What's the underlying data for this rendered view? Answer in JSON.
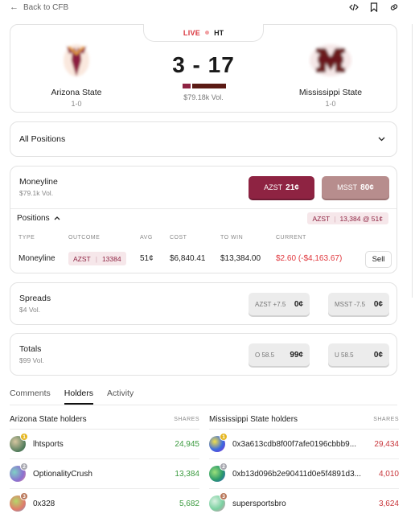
{
  "nav": {
    "back_label": "Back to CFB"
  },
  "game": {
    "live_label": "LIVE",
    "period": "HT",
    "score": "3 - 17",
    "volume": "$79.18k Vol.",
    "home": {
      "name": "Arizona State",
      "record": "1-0",
      "color": "#8e2342"
    },
    "away": {
      "name": "Mississippi State",
      "record": "1-0",
      "color": "#5b1a14"
    }
  },
  "positions_select": {
    "label": "All Positions"
  },
  "moneyline": {
    "title": "Moneyline",
    "volume": "$79.1k Vol.",
    "buttons": [
      {
        "team": "AZST",
        "price": "21¢"
      },
      {
        "team": "MSST",
        "price": "80¢"
      }
    ],
    "positions_label": "Positions",
    "position_chip": {
      "team": "AZST",
      "detail": "13,384 @ 51¢"
    },
    "table": {
      "headers": [
        "TYPE",
        "OUTCOME",
        "AVG",
        "COST",
        "TO WIN",
        "CURRENT"
      ],
      "row": {
        "type": "Moneyline",
        "outcome_team": "AZST",
        "outcome_shares": "13384",
        "avg": "51¢",
        "cost": "$6,840.41",
        "to_win": "$13,384.00",
        "current": "$2.60",
        "current_change": "(-$4,163.67)",
        "action": "Sell"
      }
    }
  },
  "spreads": {
    "title": "Spreads",
    "volume": "$4 Vol.",
    "buttons": [
      {
        "label": "AZST +7.5",
        "price": "0¢"
      },
      {
        "label": "MSST -7.5",
        "price": "0¢"
      }
    ]
  },
  "totals": {
    "title": "Totals",
    "volume": "$99 Vol.",
    "buttons": [
      {
        "label": "O 58.5",
        "price": "99¢"
      },
      {
        "label": "U 58.5",
        "price": "0¢"
      }
    ]
  },
  "tabs": [
    "Comments",
    "Holders",
    "Activity"
  ],
  "active_tab": "Holders",
  "holders": {
    "shares_label": "SHARES",
    "home": {
      "title": "Arizona State holders",
      "rows": [
        {
          "rank": "1",
          "name": "lhtsports",
          "shares": "24,945"
        },
        {
          "rank": "2",
          "name": "OptionalityCrush",
          "shares": "13,384"
        },
        {
          "rank": "3",
          "name": "0x328",
          "shares": "5,682"
        }
      ]
    },
    "away": {
      "title": "Mississippi State holders",
      "rows": [
        {
          "rank": "1",
          "name": "0x3a613cdb8f00f7afe0196cbbb9...",
          "shares": "29,434"
        },
        {
          "rank": "2",
          "name": "0xb13d096b2e90411d0e5f4891d3...",
          "shares": "4,010"
        },
        {
          "rank": "3",
          "name": "supersportsbro",
          "shares": "3,624"
        }
      ]
    }
  }
}
